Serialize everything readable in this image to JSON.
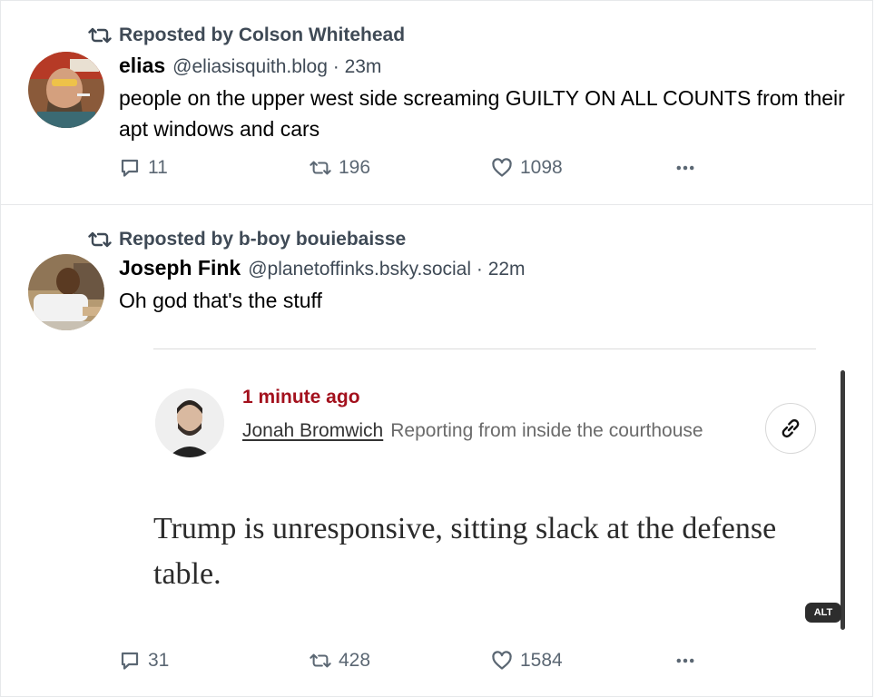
{
  "posts": [
    {
      "repost_label": "Reposted by Colson Whitehead",
      "author_name": "elias",
      "author_handle_time": "@eliasisquith.blog · 23m",
      "text": "people on the upper west side screaming GUILTY ON ALL COUNTS from their apt windows and cars",
      "replies": "11",
      "reposts": "196",
      "likes": "1098"
    },
    {
      "repost_label": "Reposted by b-boy bouiebaisse",
      "author_name": "Joseph Fink",
      "author_handle_time": "@planetoffinks.bsky.social · 22m",
      "text": "Oh god that's the stuff",
      "replies": "31",
      "reposts": "428",
      "likes": "1584",
      "embed": {
        "timestamp": "1 minute ago",
        "author": "Jonah Bromwich",
        "role": "Reporting from inside the courthouse",
        "quote": "Trump is unresponsive, sitting slack at the defense table.",
        "alt_badge": "ALT"
      }
    }
  ],
  "icons": {
    "repost": "repost-icon",
    "reply": "reply-icon",
    "like": "heart-icon",
    "more": "more-icon",
    "link": "link-icon"
  },
  "colors": {
    "muted": "#3f4a56",
    "action": "#5b6773",
    "nyt_red": "#a3111d"
  }
}
